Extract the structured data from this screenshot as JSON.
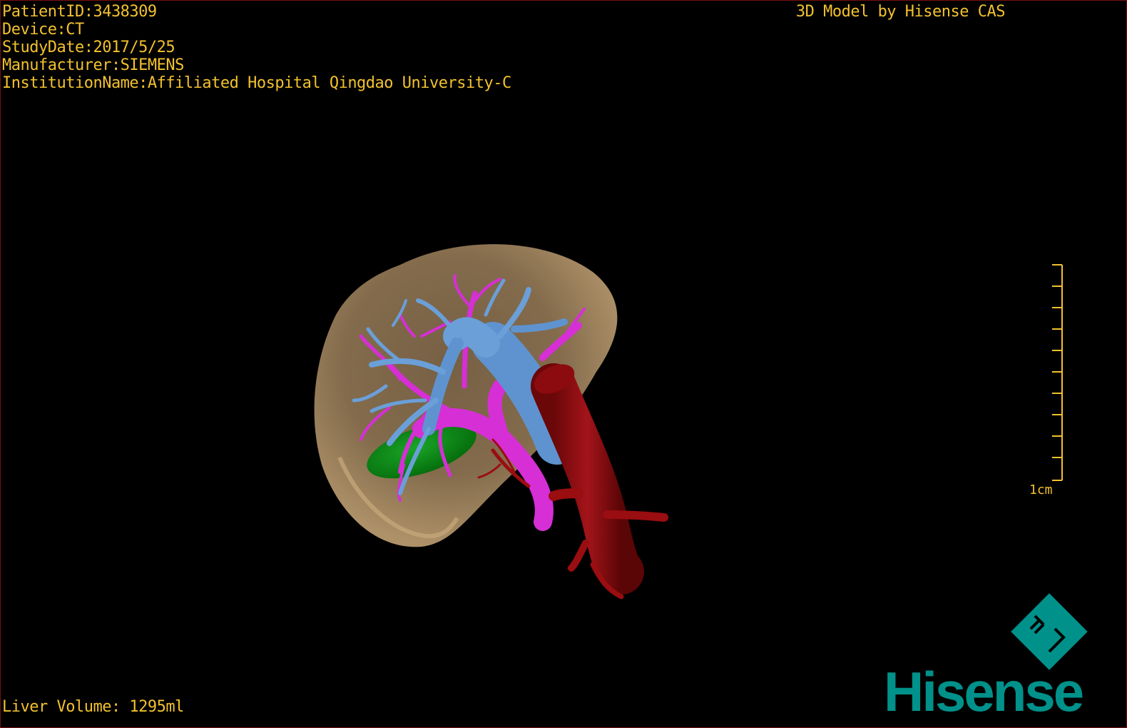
{
  "viewer": {
    "info": {
      "patient_id": "PatientID:3438309",
      "device": "Device:CT",
      "study_date": "StudyDate:2017/5/25",
      "manufacturer": "Manufacturer:SIEMENS",
      "institution": "InstitutionName:Affiliated Hospital Qingdao University-C"
    },
    "header_right": "3D Model by Hisense CAS",
    "footer": "Liver Volume: 1295ml",
    "scale_bar": {
      "label": "1cm",
      "color": "#f2c12e"
    },
    "brand": {
      "name": "Hisense",
      "color": "#00918a"
    },
    "colors": {
      "background": "#000000",
      "overlay_text": "#f2c12e",
      "liver": "#8a7150",
      "portal_vein": "#5f93cf",
      "hepatic_vein": "#d62fd6",
      "artery": "#9a0d10",
      "gallbladder": "#0f8a16",
      "frame_border": "#7a0f0f"
    },
    "icons": [
      "hisense-cas-logo-icon"
    ]
  }
}
